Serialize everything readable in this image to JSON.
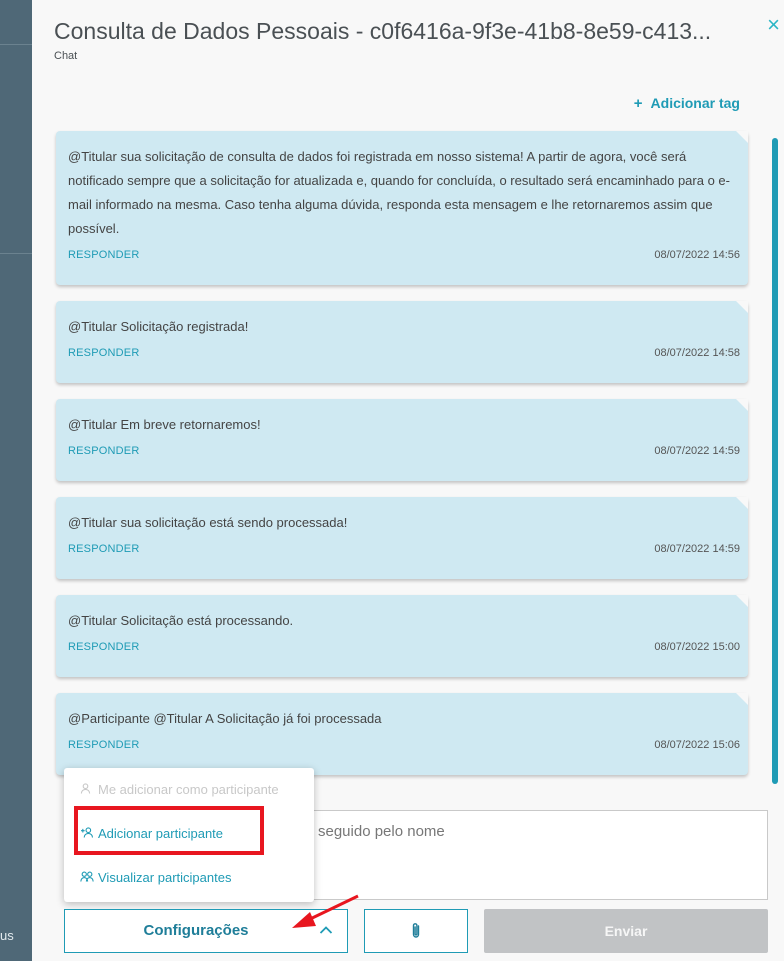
{
  "backdrop": {
    "peek_text": "us"
  },
  "header": {
    "title": "Consulta de Dados Pessoais - c0f6416a-9f3e-41b8-8e59-c413...",
    "subtitle": "Chat",
    "close_icon": "×"
  },
  "tag": {
    "icon": "+",
    "label": "Adicionar tag"
  },
  "messages": [
    {
      "text": "@Titular sua solicitação de consulta de dados foi registrada em nosso sistema! A partir de agora, você será notificado sempre que a solicitação for atualizada e, quando for concluída, o resultado será encaminhado para o e-mail informado na mesma. Caso tenha alguma dúvida, responda esta mensagem e lhe retornaremos assim que possível.",
      "reply": "RESPONDER",
      "time": "08/07/2022 14:56"
    },
    {
      "text": "@Titular Solicitação registrada!",
      "reply": "RESPONDER",
      "time": "08/07/2022 14:58"
    },
    {
      "text": "@Titular Em breve retornaremos!",
      "reply": "RESPONDER",
      "time": "08/07/2022 14:59"
    },
    {
      "text": "@Titular sua solicitação está sendo processada!",
      "reply": "RESPONDER",
      "time": "08/07/2022 14:59"
    },
    {
      "text": "@Titular Solicitação está processando.",
      "reply": "RESPONDER",
      "time": "08/07/2022 15:00"
    },
    {
      "text": "@Participante @Titular A Solicitação já foi processada",
      "reply": "RESPONDER",
      "time": "08/07/2022 15:06"
    }
  ],
  "compose": {
    "placeholder_visible": "seguido pelo nome"
  },
  "menu": {
    "items": [
      {
        "label": "Me adicionar como participante",
        "icon": "person-icon",
        "state": "disabled"
      },
      {
        "label": "Adicionar participante",
        "icon": "add-person-icon",
        "state": "enabled"
      },
      {
        "label": "Visualizar participantes",
        "icon": "people-icon",
        "state": "enabled"
      }
    ]
  },
  "footer": {
    "config_label": "Configurações",
    "config_icon": "chevron-up-icon",
    "attach_icon": "paperclip-icon",
    "send_label": "Enviar"
  },
  "colors": {
    "accent": "#1f9bb5",
    "bubble": "#cfe9f2",
    "highlight": "#e8161f",
    "disabled_button": "#c1c3c5"
  }
}
